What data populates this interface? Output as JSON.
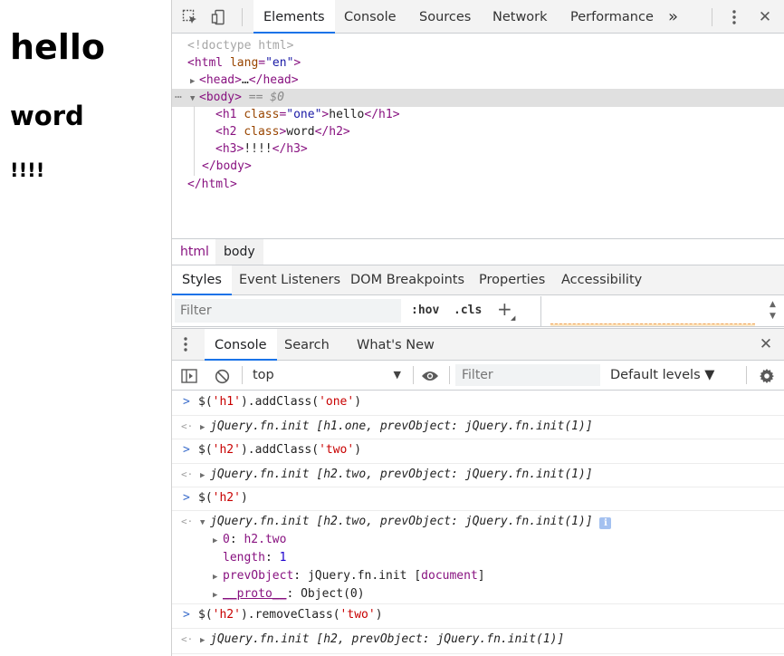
{
  "preview": {
    "h1_text": "hello",
    "h2_text": "word",
    "h3_text": "!!!!"
  },
  "toolbar": {
    "tabs": [
      {
        "label": "Elements",
        "active": true
      },
      {
        "label": "Console",
        "active": false
      },
      {
        "label": "Sources",
        "active": false
      },
      {
        "label": "Network",
        "active": false
      },
      {
        "label": "Performance",
        "active": false
      }
    ],
    "more_label": "»",
    "inspect_icon": "inspect-element-icon",
    "device_icon": "device-toolbar-icon",
    "kebab_icon": "more-options-icon",
    "close_label": "✕"
  },
  "tree": {
    "doctype": "<!doctype html>",
    "html_open_tag": "<html",
    "html_lang_attr": "lang",
    "html_lang_val": "\"en\"",
    "html_open_close": ">",
    "head_collapsed": "<head>",
    "head_ellipsis": "…",
    "head_close": "</head>",
    "body_open": "<body>",
    "body_dollar": "== $0",
    "h1_open": "<h1",
    "h1_attr": "class",
    "h1_attr_val": "\"one\"",
    "h1_text": "hello",
    "h1_close": "</h1>",
    "h2_open": "<h2",
    "h2_attr": "class",
    "h2_text": "word",
    "h2_close": "</h2>",
    "h3_open": "<h3>",
    "h3_text": "!!!!",
    "h3_close": "</h3>",
    "body_close": "</body>",
    "html_close": "</html>"
  },
  "breadcrumb": {
    "items": [
      "html",
      "body"
    ]
  },
  "styles_tabs": [
    "Styles",
    "Event Listeners",
    "DOM Breakpoints",
    "Properties",
    "Accessibility"
  ],
  "styles_filter": {
    "placeholder": "Filter",
    "hov": ":hov",
    "cls": ".cls",
    "plus": "+"
  },
  "drawer": {
    "tabs": [
      "Console",
      "Search",
      "What's New"
    ],
    "close_label": "✕"
  },
  "console_toolbar": {
    "context": "top",
    "filter_placeholder": "Filter",
    "levels": "Default levels ▼"
  },
  "console": {
    "cmd1": "$(",
    "cmd1_str": "'h1'",
    "cmd1_rest": ").addClass(",
    "cmd1_arg": "'one'",
    "cmd1_end": ")",
    "res1_a": "jQuery.fn.init [h1.one, prevObject: jQuery.fn.init(1)]",
    "cmd2": "$(",
    "cmd2_str": "'h2'",
    "cmd2_rest": ").addClass(",
    "cmd2_arg": "'two'",
    "cmd2_end": ")",
    "res2_a": "jQuery.fn.init [h2.two, prevObject: jQuery.fn.init(1)]",
    "cmd3": "$(",
    "cmd3_str": "'h2'",
    "cmd3_end": ")",
    "res3_a": "jQuery.fn.init [h2.two, prevObject: jQuery.fn.init(1)]",
    "res3_info": "i",
    "res3_item0_key": "0",
    "res3_item0_val": "h2.two",
    "res3_length_key": "length",
    "res3_length_val": "1",
    "res3_prev_key": "prevObject",
    "res3_prev_val": "jQuery.fn.init [",
    "res3_prev_doc": "document",
    "res3_prev_end": "]",
    "res3_proto_key": "__proto__",
    "res3_proto_val": "Object(0)",
    "cmd4": "$(",
    "cmd4_str": "'h2'",
    "cmd4_rest": ").removeClass(",
    "cmd4_arg": "'two'",
    "cmd4_end": ")",
    "res4_a": "jQuery.fn.init [h2, prevObject: jQuery.fn.init(1)]"
  }
}
